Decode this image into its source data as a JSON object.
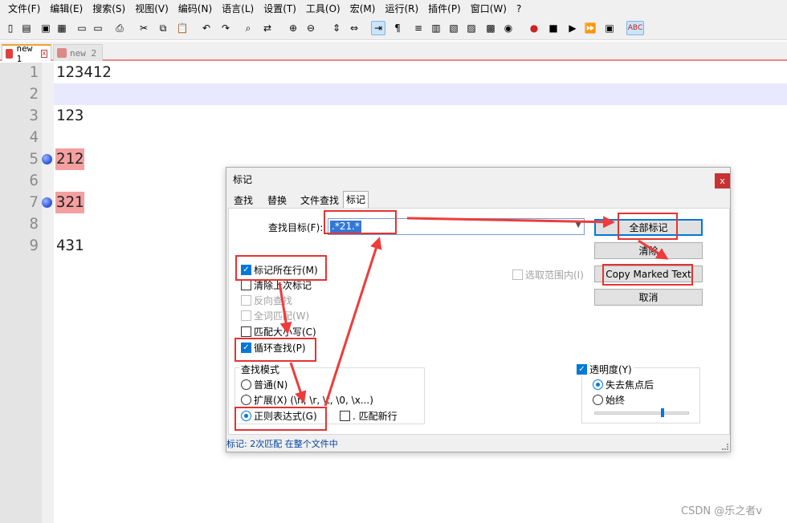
{
  "menubar": [
    "文件(F)",
    "编辑(E)",
    "搜索(S)",
    "视图(V)",
    "编码(N)",
    "语言(L)",
    "设置(T)",
    "工具(O)",
    "宏(M)",
    "运行(R)",
    "插件(P)",
    "窗口(W)",
    "?"
  ],
  "toolbar": {
    "icons": [
      "new-icon",
      "open-icon",
      "save-icon",
      "save-all-icon",
      "close-icon",
      "close-all-icon",
      "print-icon",
      "cut-icon",
      "copy-icon",
      "paste-icon",
      "undo-icon",
      "redo-icon",
      "find-icon",
      "replace-icon",
      "zoom-in-icon",
      "zoom-out-icon",
      "sync-v-icon",
      "sync-h-icon",
      "wrap-icon",
      "show-all-icon",
      "indent-guide-icon",
      "udl-icon",
      "doc-map-icon",
      "func-list-icon",
      "folder-ws-icon",
      "monitor-icon",
      "record-icon",
      "stop-icon",
      "play-icon",
      "play-multi-icon",
      "save-macro-icon",
      "spellcheck-icon"
    ],
    "spellcheck_label": "ABC"
  },
  "tabs": [
    {
      "label": "new 1",
      "active": true
    },
    {
      "label": "new 2",
      "active": false
    }
  ],
  "editor": {
    "lines": [
      {
        "num": "1",
        "text": "123412",
        "marked": false,
        "bookmark": false
      },
      {
        "num": "2",
        "text": "",
        "marked": false,
        "bookmark": false
      },
      {
        "num": "3",
        "text": "123",
        "marked": false,
        "bookmark": false
      },
      {
        "num": "4",
        "text": "",
        "marked": false,
        "bookmark": false
      },
      {
        "num": "5",
        "text": "212",
        "marked": true,
        "bookmark": true
      },
      {
        "num": "6",
        "text": "",
        "marked": false,
        "bookmark": false
      },
      {
        "num": "7",
        "text": "321",
        "marked": true,
        "bookmark": true
      },
      {
        "num": "8",
        "text": "",
        "marked": false,
        "bookmark": false
      },
      {
        "num": "9",
        "text": "431",
        "marked": false,
        "bookmark": false
      }
    ],
    "current_line": 2
  },
  "dialog": {
    "title": "标记",
    "close": "x",
    "tabs": [
      "查找",
      "替换",
      "文件查找",
      "标记"
    ],
    "find_label": "查找目标(F):",
    "find_value": ".*21.*",
    "mark_all": "全部标记",
    "clear": "清除",
    "copy_marked": "Copy Marked Text",
    "cancel": "取消",
    "in_selection": "选取范围内(I)",
    "options": {
      "bookmark_line": "标记所在行(M)",
      "purge": "清除上次标记",
      "backward": "反向查找",
      "whole_word": "全词匹配(W)",
      "match_case": "匹配大小写(C)",
      "wrap": "循环查找(P)"
    },
    "search_mode": {
      "title": "查找模式",
      "normal": "普通(N)",
      "extended": "扩展(X) (\\n, \\r, \\t, \\0, \\x...)",
      "regex": "正则表达式(G)",
      "dot_newline": ". 匹配新行"
    },
    "transparency": {
      "title": "透明度(Y)",
      "on_lose_focus": "失去焦点后",
      "always": "始终",
      "level": 0.7
    },
    "status": "标记: 2次匹配 在整个文件中"
  },
  "watermark": "CSDN @乐之者v"
}
